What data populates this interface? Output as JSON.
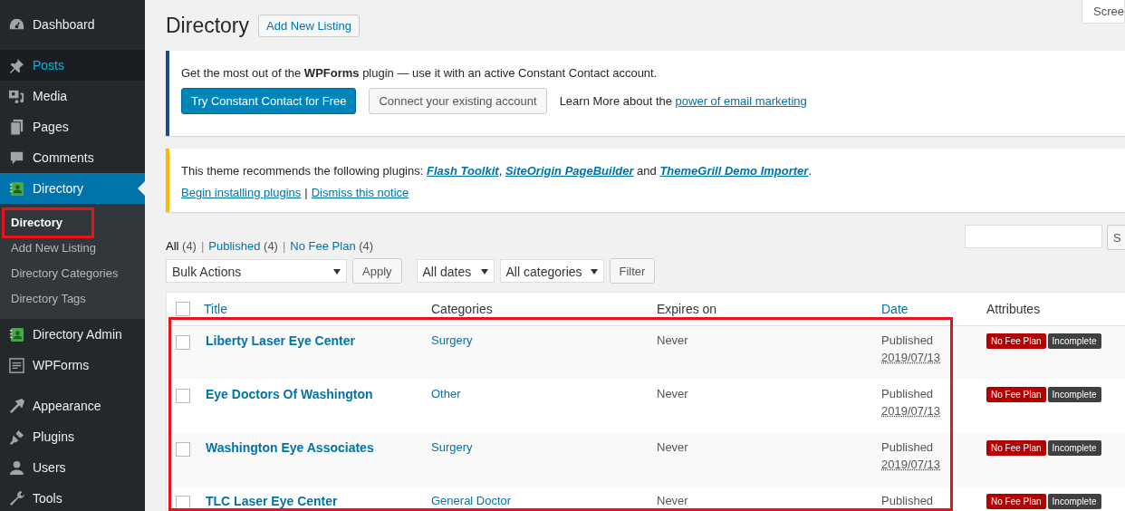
{
  "sidebar": {
    "groups": [
      {
        "items": [
          {
            "label": "Dashboard",
            "selected": false,
            "hovered": false
          }
        ]
      },
      {
        "items": [
          {
            "label": "Posts",
            "selected": false,
            "hovered": true
          },
          {
            "label": "Media",
            "selected": false,
            "hovered": false
          },
          {
            "label": "Pages",
            "selected": false,
            "hovered": false
          },
          {
            "label": "Comments",
            "selected": false,
            "hovered": false
          },
          {
            "label": "Directory",
            "selected": true,
            "hovered": false,
            "submenu": [
              {
                "label": "Directory",
                "selected": true,
                "highlighted": true
              },
              {
                "label": "Add New Listing",
                "selected": false,
                "highlighted": false
              },
              {
                "label": "Directory Categories",
                "selected": false,
                "highlighted": false
              },
              {
                "label": "Directory Tags",
                "selected": false,
                "highlighted": false
              }
            ]
          },
          {
            "label": "Directory Admin",
            "selected": false,
            "hovered": false
          },
          {
            "label": "WPForms",
            "selected": false,
            "hovered": false
          }
        ]
      },
      {
        "items": [
          {
            "label": "Appearance",
            "selected": false,
            "hovered": false
          },
          {
            "label": "Plugins",
            "selected": false,
            "hovered": false
          },
          {
            "label": "Users",
            "selected": false,
            "hovered": false
          },
          {
            "label": "Tools",
            "selected": false,
            "hovered": false
          }
        ]
      }
    ]
  },
  "screen_options": {
    "label": "Scree"
  },
  "header": {
    "title": "Directory",
    "add_button": "Add New Listing"
  },
  "notices": [
    {
      "kind": "info",
      "message": "Get the most out of the **WPForms** plugin — use it with an active Constant Contact account.",
      "primary_button": "Try Constant Contact for Free",
      "secondary_button": "Connect your existing account",
      "learn_more": "Learn More about the",
      "learn_more_link": "power of email marketing"
    },
    {
      "kind": "warning",
      "parts": [
        {
          "kind": "text",
          "text": "This theme recommends the following plugins: "
        },
        {
          "kind": "link",
          "text": "Flash Toolkit"
        },
        {
          "kind": "text",
          "text": ", "
        },
        {
          "kind": "link",
          "text": "SiteOrigin PageBuilder"
        },
        {
          "kind": "text",
          "text": " and "
        },
        {
          "kind": "link",
          "text": "ThemeGrill Demo Importer"
        },
        {
          "kind": "text",
          "text": "."
        }
      ],
      "links": [
        "Begin installing plugins",
        "Dismiss this notice"
      ],
      "separator": "|"
    }
  ],
  "views": [
    {
      "label": "All",
      "count": "(4)",
      "selected": true
    },
    {
      "label": "Published",
      "count": "(4)",
      "selected": false
    },
    {
      "label": "No Fee Plan",
      "count": "(4)",
      "selected": false
    }
  ],
  "views_separator": "|",
  "search": {
    "button": "S"
  },
  "filters": {
    "bulk_actions": "Bulk Actions",
    "apply": "Apply",
    "dates": "All dates",
    "categories": "All categories",
    "filter": "Filter"
  },
  "table": {
    "highlighted": true,
    "header_checked": false,
    "columns": [
      {
        "label": "Title",
        "sortable": true
      },
      {
        "label": "Categories",
        "sortable": false
      },
      {
        "label": "Expires on",
        "sortable": false
      },
      {
        "label": "Date",
        "sortable": true
      },
      {
        "label": "Attributes",
        "sortable": false
      }
    ],
    "rows": [
      {
        "checked": false,
        "title": "Liberty Laser Eye Center",
        "category": "Surgery",
        "expires": "Never",
        "status": "Published",
        "date": "2019/07/13",
        "badges": [
          {
            "label": "No Fee Plan",
            "color": "#b30000"
          },
          {
            "label": "Incomplete",
            "color": "#404040"
          }
        ]
      },
      {
        "checked": false,
        "title": "Eye Doctors Of Washington",
        "category": "Other",
        "expires": "Never",
        "status": "Published",
        "date": "2019/07/13",
        "badges": [
          {
            "label": "No Fee Plan",
            "color": "#b30000"
          },
          {
            "label": "Incomplete",
            "color": "#404040"
          }
        ]
      },
      {
        "checked": false,
        "title": "Washington Eye Associates",
        "category": "Surgery",
        "expires": "Never",
        "status": "Published",
        "date": "2019/07/13",
        "badges": [
          {
            "label": "No Fee Plan",
            "color": "#b30000"
          },
          {
            "label": "Incomplete",
            "color": "#404040"
          }
        ]
      },
      {
        "checked": false,
        "title": "TLC Laser Eye Center",
        "category": "General Doctor",
        "expires": "Never",
        "status": "Published",
        "badges": [
          {
            "label": "No Fee Plan",
            "color": "#b30000"
          },
          {
            "label": "Incomplete",
            "color": "#404040"
          }
        ]
      }
    ]
  }
}
